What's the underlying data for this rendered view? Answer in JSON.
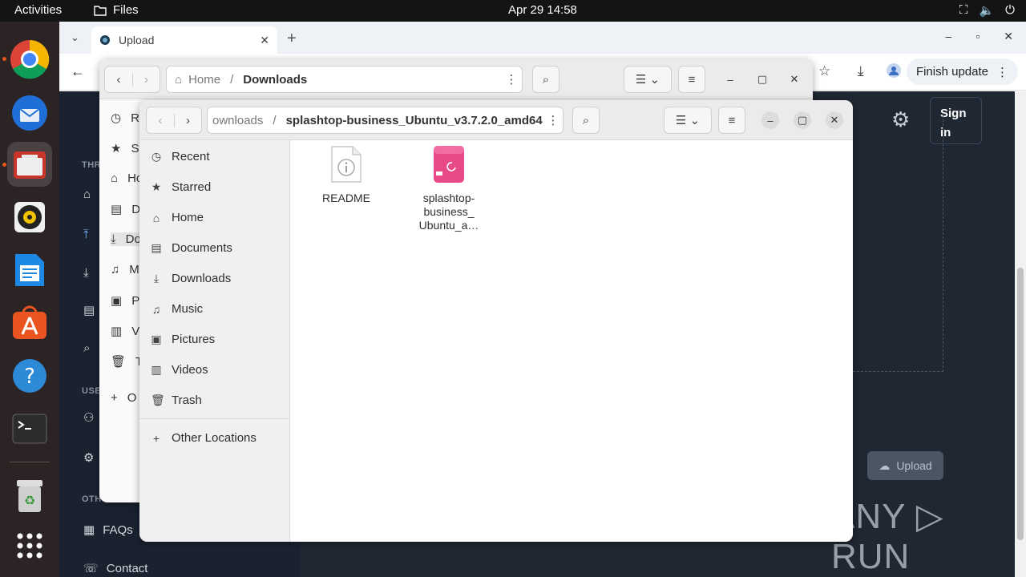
{
  "topbar": {
    "activities": "Activities",
    "app_name": "Files",
    "clock": "Apr 29  14:58"
  },
  "browser": {
    "tab_title": "Upload",
    "finish_update": "Finish update",
    "sign_in": "Sign in",
    "upload_button": "Upload",
    "sidebar_sections": {
      "threat": "THR",
      "user": "USE",
      "other": "OTH"
    },
    "sidebar_items": {
      "faqs": "FAQs",
      "contact": "Contact"
    }
  },
  "files_back": {
    "path_home": "Home",
    "path_current": "Downloads",
    "sidebar": [
      "Re",
      "St",
      "Ho",
      "Do",
      "Do",
      "Mu",
      "Pi",
      "Vi",
      "Tr",
      "O"
    ]
  },
  "files_front": {
    "path_prev": "ownloads",
    "path_current": "splashtop-business_Ubuntu_v3.7.2.0_amd64",
    "sidebar": {
      "recent": "Recent",
      "starred": "Starred",
      "home": "Home",
      "documents": "Documents",
      "downloads": "Downloads",
      "music": "Music",
      "pictures": "Pictures",
      "videos": "Videos",
      "trash": "Trash",
      "other_locations": "Other Locations"
    },
    "files": [
      {
        "name": "README"
      },
      {
        "name_line1": "splashtop-",
        "name_line2": "business_",
        "name_line3": "Ubuntu_a…"
      }
    ]
  },
  "watermark": "ANY ▷ RUN"
}
